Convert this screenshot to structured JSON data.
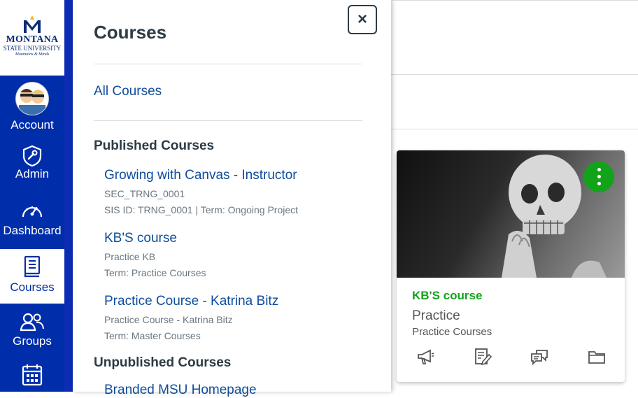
{
  "brand": {
    "logo_line1": "MONTANA",
    "logo_line2": "STATE UNIVERSITY",
    "logo_tagline": "Mountains & Minds",
    "nav_color": "#002eab",
    "link_color": "#0e4c9b",
    "card_color": "#13a31a"
  },
  "global_nav": [
    {
      "label": "Account",
      "icon": "account-avatar"
    },
    {
      "label": "Admin",
      "icon": "shield-wrench-icon"
    },
    {
      "label": "Dashboard",
      "icon": "speedometer-icon"
    },
    {
      "label": "Courses",
      "icon": "book-icon",
      "active": true
    },
    {
      "label": "Groups",
      "icon": "people-icon"
    },
    {
      "label": "",
      "icon": "calendar-icon"
    }
  ],
  "tray": {
    "title": "Courses",
    "close_label": "×",
    "all_courses": "All Courses",
    "published_heading": "Published Courses",
    "unpublished_heading": "Unpublished Courses",
    "published": [
      {
        "title": "Growing with Canvas - Instructor",
        "lines": [
          "SEC_TRNG_0001",
          "SIS ID: TRNG_0001 | Term: Ongoing Project"
        ]
      },
      {
        "title": "KB'S course",
        "lines": [
          "Practice KB",
          "Term: Practice Courses"
        ]
      },
      {
        "title": "Practice Course - Katrina Bitz",
        "lines": [
          "Practice Course - Katrina Bitz",
          "Term: Master Courses"
        ]
      }
    ],
    "unpublished": [
      {
        "title": "Branded MSU Homepage"
      }
    ]
  },
  "card": {
    "name": "KB'S course",
    "code": "Practice",
    "term": "Practice Courses",
    "actions": [
      "announcements-icon",
      "assignments-icon",
      "discussions-icon",
      "files-icon"
    ]
  }
}
